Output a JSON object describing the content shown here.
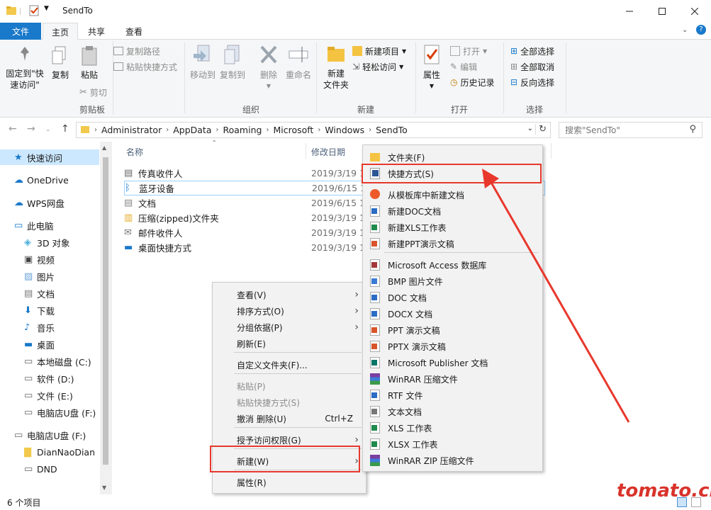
{
  "window": {
    "title": "SendTo"
  },
  "ribbon_tabs": {
    "file": "文件",
    "home": "主页",
    "share": "共享",
    "view": "查看"
  },
  "ribbon": {
    "clipboard": {
      "pin": "固定到\"快\n速访问\"",
      "copy": "复制",
      "paste": "粘贴",
      "copy_path": "复制路径",
      "paste_shortcut": "粘贴快捷方式",
      "cut": "剪切",
      "label": "剪贴板"
    },
    "organize": {
      "move_to": "移动到",
      "copy_to": "复制到",
      "delete": "删除",
      "rename": "重命名",
      "label": "组织"
    },
    "new": {
      "new_folder": "新建\n文件夹",
      "new_item": "新建项目",
      "easy_access": "轻松访问",
      "label": "新建"
    },
    "open": {
      "properties": "属性",
      "open": "打开",
      "edit": "编辑",
      "history": "历史记录",
      "label": "打开"
    },
    "select": {
      "select_all": "全部选择",
      "select_none": "全部取消",
      "invert": "反向选择",
      "label": "选择"
    }
  },
  "address": {
    "crumbs": [
      "Administrator",
      "AppData",
      "Roaming",
      "Microsoft",
      "Windows",
      "SendTo"
    ],
    "search_placeholder": "搜索\"SendTo\""
  },
  "nav": {
    "items": [
      {
        "label": "快速访问",
        "icon": "star-icon"
      },
      {
        "label": "OneDrive",
        "icon": "cloud-icon"
      },
      {
        "label": "WPS网盘",
        "icon": "cloud-icon"
      },
      {
        "label": "此电脑",
        "icon": "computer-icon"
      },
      {
        "label": "3D 对象",
        "icon": "cube-icon"
      },
      {
        "label": "视频",
        "icon": "video-icon"
      },
      {
        "label": "图片",
        "icon": "picture-icon"
      },
      {
        "label": "文档",
        "icon": "document-icon"
      },
      {
        "label": "下载",
        "icon": "download-icon"
      },
      {
        "label": "音乐",
        "icon": "music-icon"
      },
      {
        "label": "桌面",
        "icon": "desktop-icon"
      },
      {
        "label": "本地磁盘 (C:)",
        "icon": "drive-icon"
      },
      {
        "label": "软件 (D:)",
        "icon": "drive-icon"
      },
      {
        "label": "文件 (E:)",
        "icon": "drive-icon"
      },
      {
        "label": "电脑店U盘 (F:)",
        "icon": "usb-drive-icon"
      },
      {
        "label": "电脑店U盘 (F:)",
        "icon": "usb-drive-icon"
      },
      {
        "label": "DianNaoDian",
        "icon": "folder-icon"
      },
      {
        "label": "DND",
        "icon": "drive-icon"
      }
    ]
  },
  "filelist": {
    "col_name": "名称",
    "col_date": "修改日期",
    "rows": [
      {
        "name": "传真收件人",
        "date": "2019/3/19 1"
      },
      {
        "name": "蓝牙设备",
        "date": "2019/6/15 1"
      },
      {
        "name": "文档",
        "date": "2019/6/15 1"
      },
      {
        "name": "压缩(zipped)文件夹",
        "date": "2019/3/19 1"
      },
      {
        "name": "邮件收件人",
        "date": "2019/3/19 1"
      },
      {
        "name": "桌面快捷方式",
        "date": "2019/3/19 1"
      }
    ]
  },
  "status": {
    "count": "6 个项目"
  },
  "context_menu": {
    "items": [
      {
        "label": "查看(V)",
        "submenu": true
      },
      {
        "label": "排序方式(O)",
        "submenu": true
      },
      {
        "label": "分组依据(P)",
        "submenu": true
      },
      {
        "label": "刷新(E)"
      },
      {
        "label": "自定义文件夹(F)..."
      },
      {
        "label": "粘贴(P)",
        "disabled": true
      },
      {
        "label": "粘贴快捷方式(S)",
        "disabled": true
      },
      {
        "label": "撤消 删除(U)",
        "shortcut": "Ctrl+Z"
      },
      {
        "label": "授予访问权限(G)",
        "submenu": true
      },
      {
        "label": "新建(W)",
        "submenu": true
      },
      {
        "label": "属性(R)"
      }
    ]
  },
  "new_submenu": {
    "items": [
      {
        "label": "文件夹(F)",
        "icon": "folder-icon",
        "color": "#f5c342"
      },
      {
        "label": "快捷方式(S)",
        "icon": "shortcut-icon",
        "color": "#2b5797"
      },
      {
        "label": "从模板库中新建文档",
        "icon": "wps-template-icon",
        "color": "#ef5a2a"
      },
      {
        "label": "新建DOC文档",
        "icon": "doc-icon",
        "color": "#2b6cc4"
      },
      {
        "label": "新建XLS工作表",
        "icon": "xls-icon",
        "color": "#1e8a4c"
      },
      {
        "label": "新建PPT演示文稿",
        "icon": "ppt-icon",
        "color": "#d9542b"
      },
      {
        "label": "Microsoft Access 数据库",
        "icon": "access-icon",
        "color": "#a4373a"
      },
      {
        "label": "BMP 图片文件",
        "icon": "image-icon",
        "color": "#3a7bd5"
      },
      {
        "label": "DOC 文档",
        "icon": "doc-icon",
        "color": "#2b6cc4"
      },
      {
        "label": "DOCX 文档",
        "icon": "doc-icon",
        "color": "#2b6cc4"
      },
      {
        "label": "PPT 演示文稿",
        "icon": "ppt-icon",
        "color": "#d9542b"
      },
      {
        "label": "PPTX 演示文稿",
        "icon": "ppt-icon",
        "color": "#d9542b"
      },
      {
        "label": "Microsoft Publisher 文档",
        "icon": "publisher-icon",
        "color": "#077568"
      },
      {
        "label": "WinRAR 压缩文件",
        "icon": "winrar-icon",
        "color": "#7b3fa0"
      },
      {
        "label": "RTF 文件",
        "icon": "doc-icon",
        "color": "#2b6cc4"
      },
      {
        "label": "文本文档",
        "icon": "text-icon",
        "color": "#777777"
      },
      {
        "label": "XLS 工作表",
        "icon": "xls-icon",
        "color": "#1e8a4c"
      },
      {
        "label": "XLSX 工作表",
        "icon": "xls-icon",
        "color": "#1e8a4c"
      },
      {
        "label": "WinRAR ZIP 压缩文件",
        "icon": "winrar-icon",
        "color": "#7b3fa0"
      }
    ]
  },
  "watermark": "tomato.cm",
  "colors": {
    "accent": "#1979ca",
    "highlight": "#e8382d",
    "selected": "#cce8ff"
  }
}
